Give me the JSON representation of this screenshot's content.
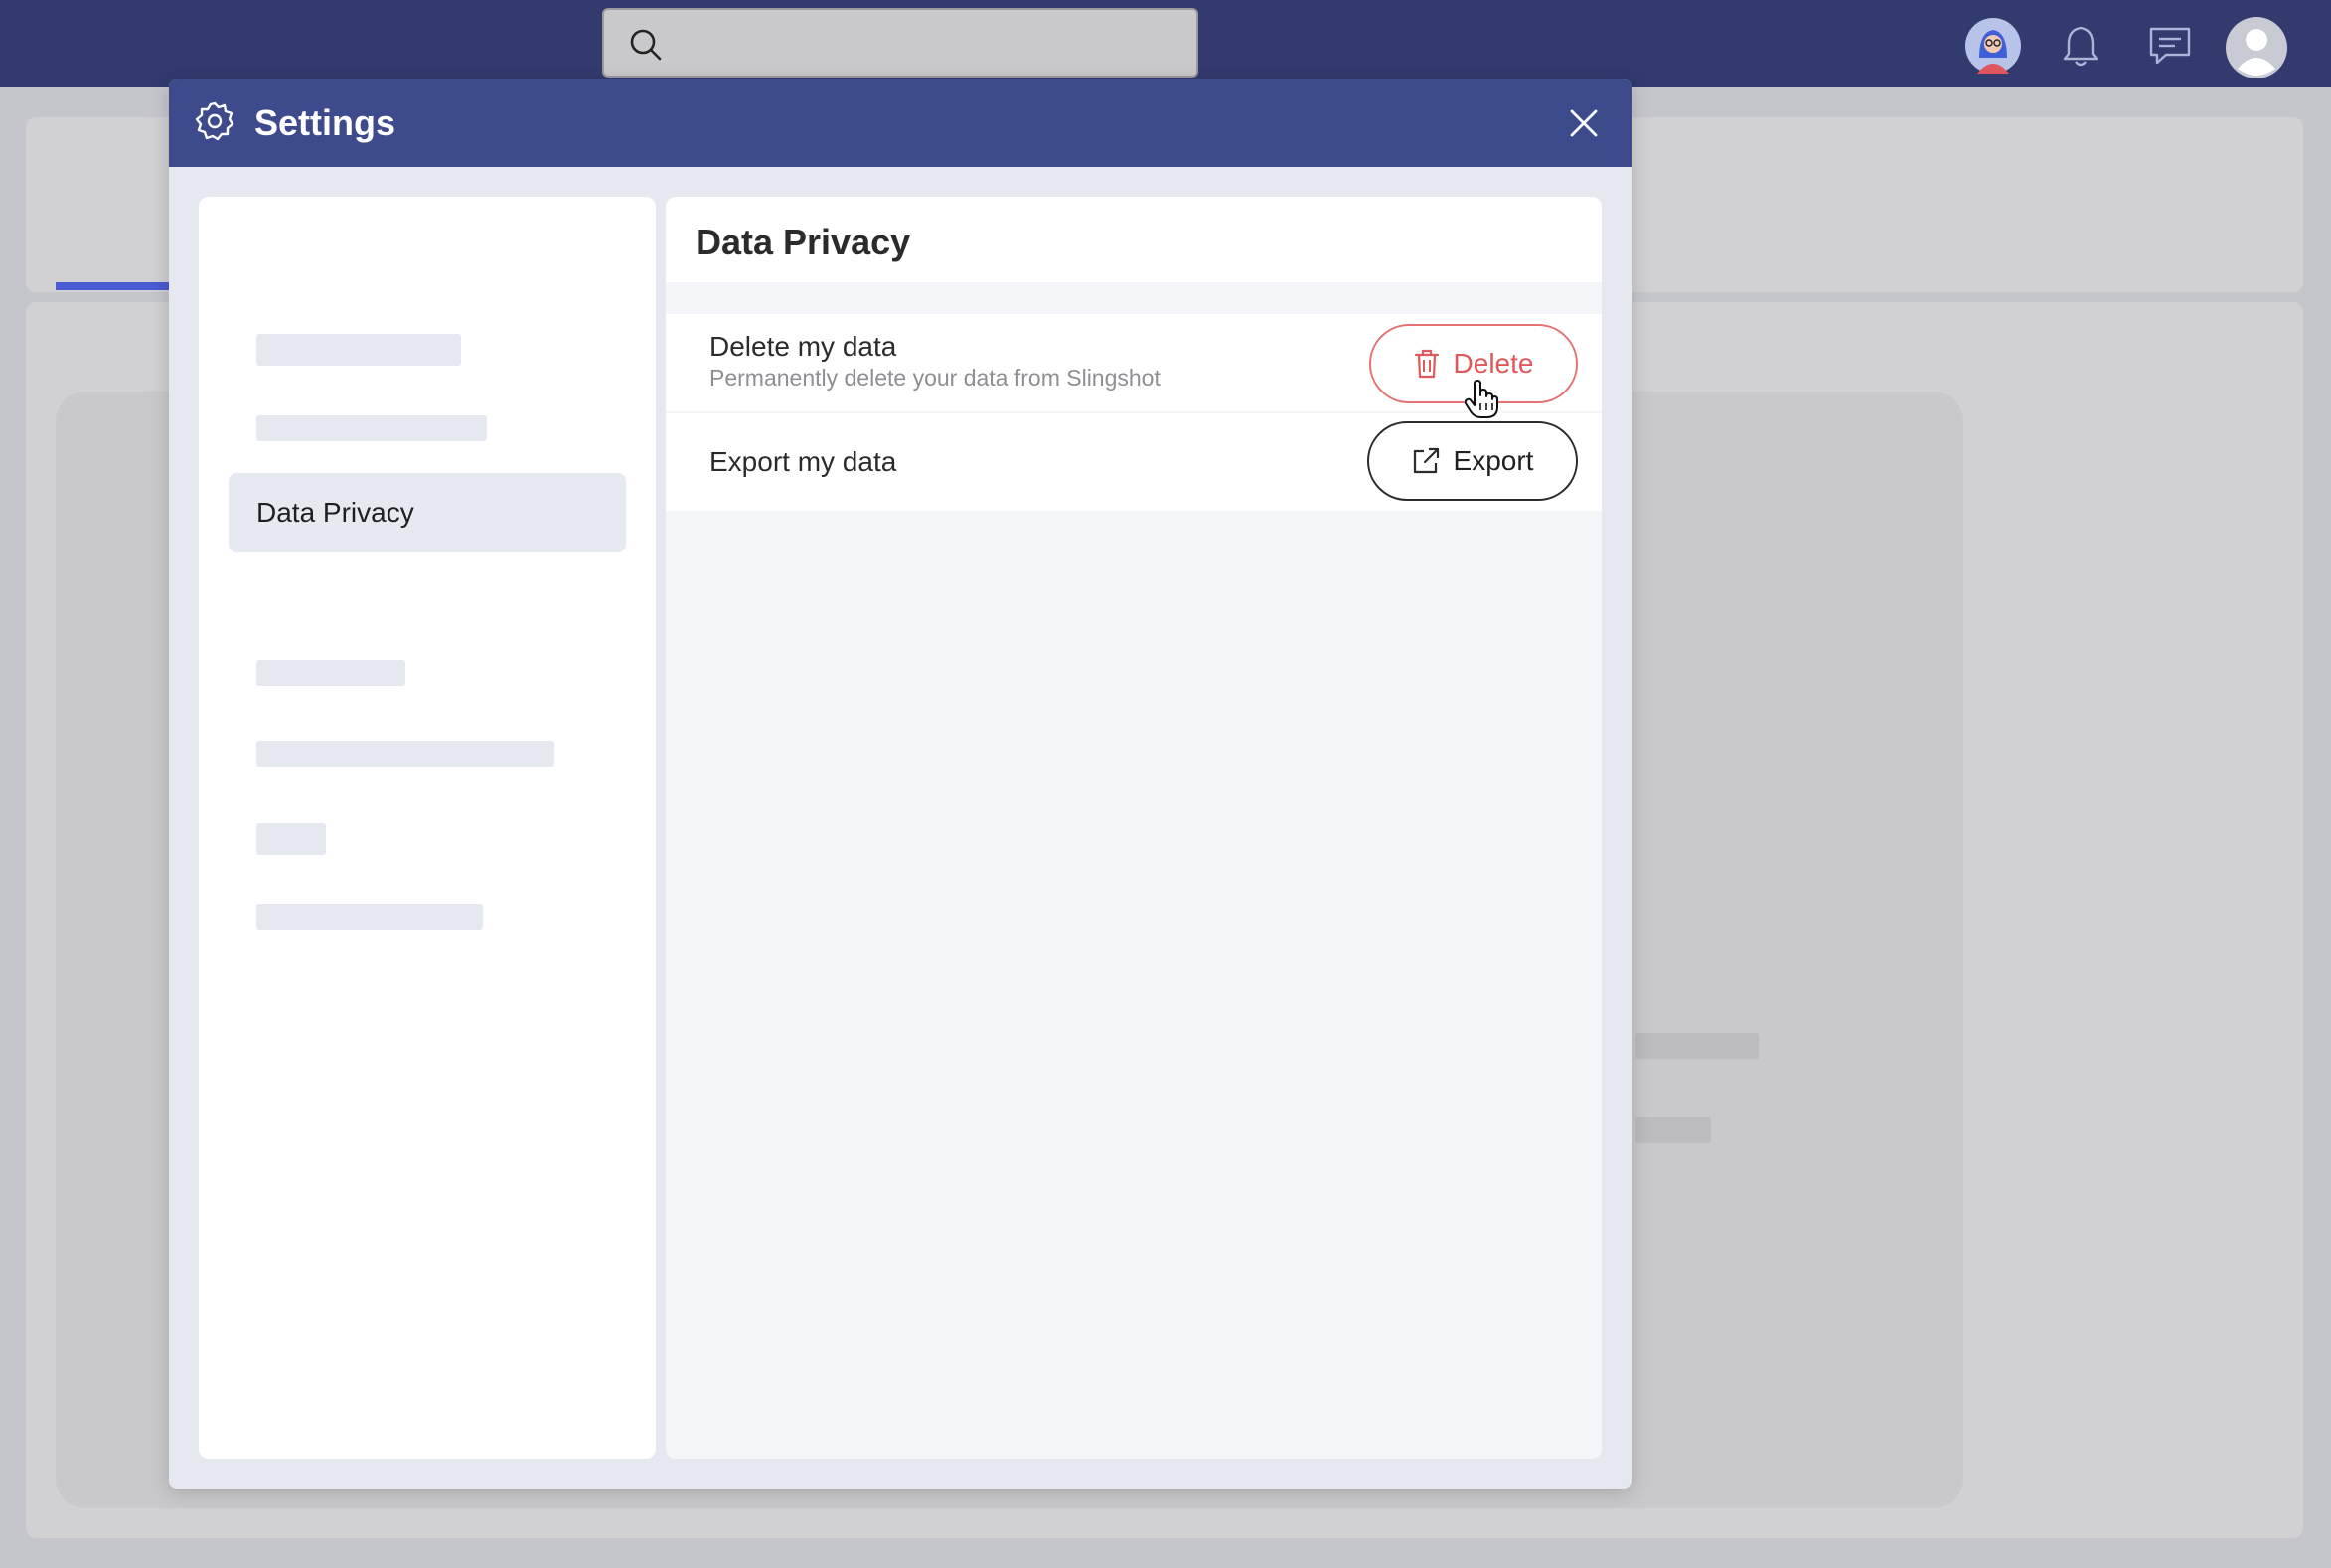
{
  "topbar": {
    "search": {
      "placeholder": ""
    },
    "icons": [
      "search-icon",
      "user-avatar",
      "bell-icon",
      "chat-icon",
      "profile-icon"
    ]
  },
  "dialog": {
    "title": "Settings",
    "close_icon": "close-icon",
    "nav": {
      "active_label": "Data Privacy"
    },
    "content": {
      "title": "Data Privacy",
      "rows": [
        {
          "title": "Delete my data",
          "subtitle": "Permanently delete your data from Slingshot",
          "button_label": "Delete",
          "button_icon": "trash-icon"
        },
        {
          "title": "Export my data",
          "button_label": "Export",
          "button_icon": "external-link-icon"
        }
      ]
    }
  },
  "colors": {
    "topbar": "#323a6e",
    "dialog_header": "#3d4a8c",
    "delete": "#e0585b",
    "accent_blue": "#4a5bd4"
  }
}
